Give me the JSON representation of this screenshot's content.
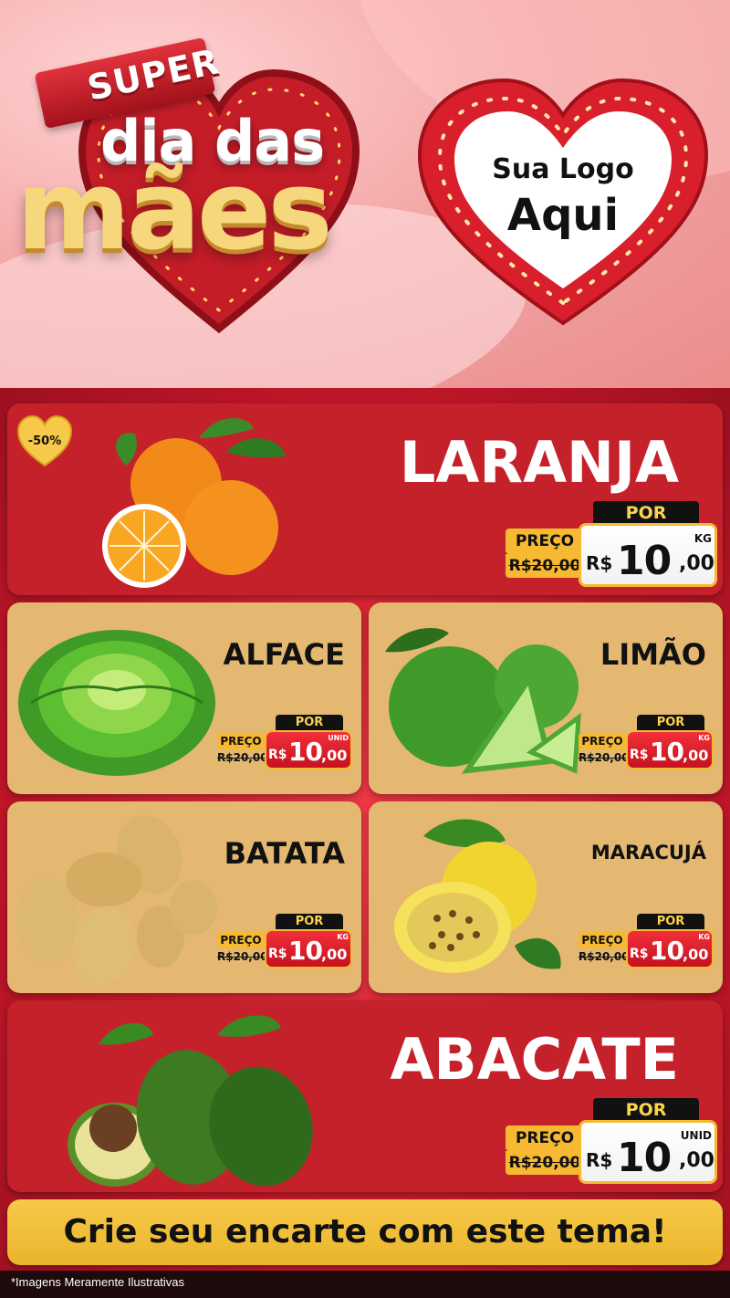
{
  "header": {
    "super": "SUPER",
    "dia_das": "dia das",
    "maes": "mães",
    "logo_line1": "Sua Logo",
    "logo_line2": "Aqui"
  },
  "badge": {
    "text": "-50%"
  },
  "products": [
    {
      "name": "LARANJA",
      "preco_label": "PREÇO",
      "old_price": "R$20,00",
      "por_label": "POR",
      "currency": "R$",
      "price_int": "10",
      "price_cents": ",00",
      "unit": "KG"
    },
    {
      "name": "ALFACE",
      "preco_label": "PREÇO",
      "old_price": "R$20,00",
      "por_label": "POR",
      "currency": "R$",
      "price_int": "10",
      "price_cents": ",00",
      "unit": "UNID"
    },
    {
      "name": "LIMÃO",
      "preco_label": "PREÇO",
      "old_price": "R$20,00",
      "por_label": "POR",
      "currency": "R$",
      "price_int": "10",
      "price_cents": ",00",
      "unit": "KG"
    },
    {
      "name": "BATATA",
      "preco_label": "PREÇO",
      "old_price": "R$20,00",
      "por_label": "POR",
      "currency": "R$",
      "price_int": "10",
      "price_cents": ",00",
      "unit": "KG"
    },
    {
      "name": "MARACUJÁ",
      "preco_label": "PREÇO",
      "old_price": "R$20,00",
      "por_label": "POR",
      "currency": "R$",
      "price_int": "10",
      "price_cents": ",00",
      "unit": "KG"
    },
    {
      "name": "ABACATE",
      "preco_label": "PREÇO",
      "old_price": "R$20,00",
      "por_label": "POR",
      "currency": "R$",
      "price_int": "10",
      "price_cents": ",00",
      "unit": "UNID"
    }
  ],
  "cta": "Crie seu encarte com este tema!",
  "disclaimer": "*Imagens Meramente Ilustrativas",
  "colors": {
    "red": "#c5212b",
    "tan": "#e4b871",
    "gold": "#f6b931",
    "pink": "#f4a8a8"
  },
  "icons": [
    "orange-icon",
    "lettuce-icon",
    "lime-icon",
    "potato-icon",
    "passion-fruit-icon",
    "avocado-icon",
    "heart-icon"
  ]
}
